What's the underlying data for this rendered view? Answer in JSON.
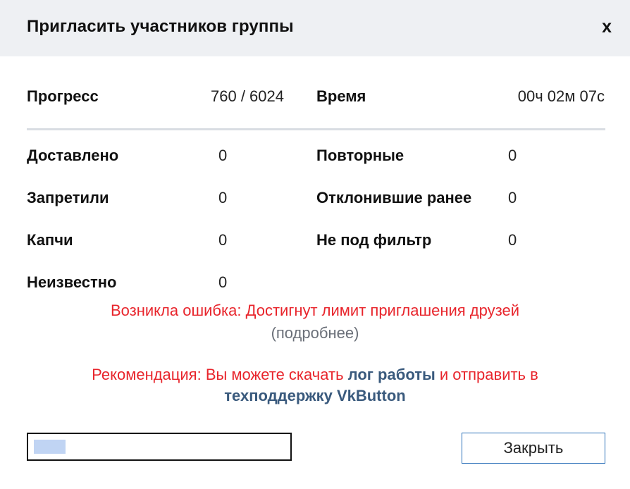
{
  "dialog": {
    "title": "Пригласить участников группы",
    "close_glyph": "x"
  },
  "progress_row": {
    "progress_label": "Прогресс",
    "progress_value": "760 / 6024",
    "time_label": "Время",
    "time_value": "00ч 02м 07с"
  },
  "stats_left": [
    {
      "label": "Доставлено",
      "value": "0"
    },
    {
      "label": "Запретили",
      "value": "0"
    },
    {
      "label": "Капчи",
      "value": "0"
    },
    {
      "label": "Неизвестно",
      "value": "0"
    }
  ],
  "stats_right": [
    {
      "label": "Повторные",
      "value": "0"
    },
    {
      "label": "Отклонившие ранее",
      "value": "0"
    },
    {
      "label": "Не под фильтр",
      "value": "0"
    }
  ],
  "error": {
    "message": "Возникла ошибка: Достигнут лимит приглашения друзей",
    "details_link": "(подробнее)"
  },
  "recommendation": {
    "prefix": "Рекомендация: Вы можете скачать ",
    "log_link": "лог работы",
    "middle": " и отправить в",
    "support_link": "техподдержку VkButton"
  },
  "footer": {
    "progress_fraction": 0.126,
    "close_button": "Закрыть"
  },
  "colors": {
    "error": "#e8252c",
    "link": "#3a5a7d",
    "header_bg": "#eef0f3",
    "progress_fill": "#c0d4f3",
    "button_border": "#2a6fb8"
  }
}
